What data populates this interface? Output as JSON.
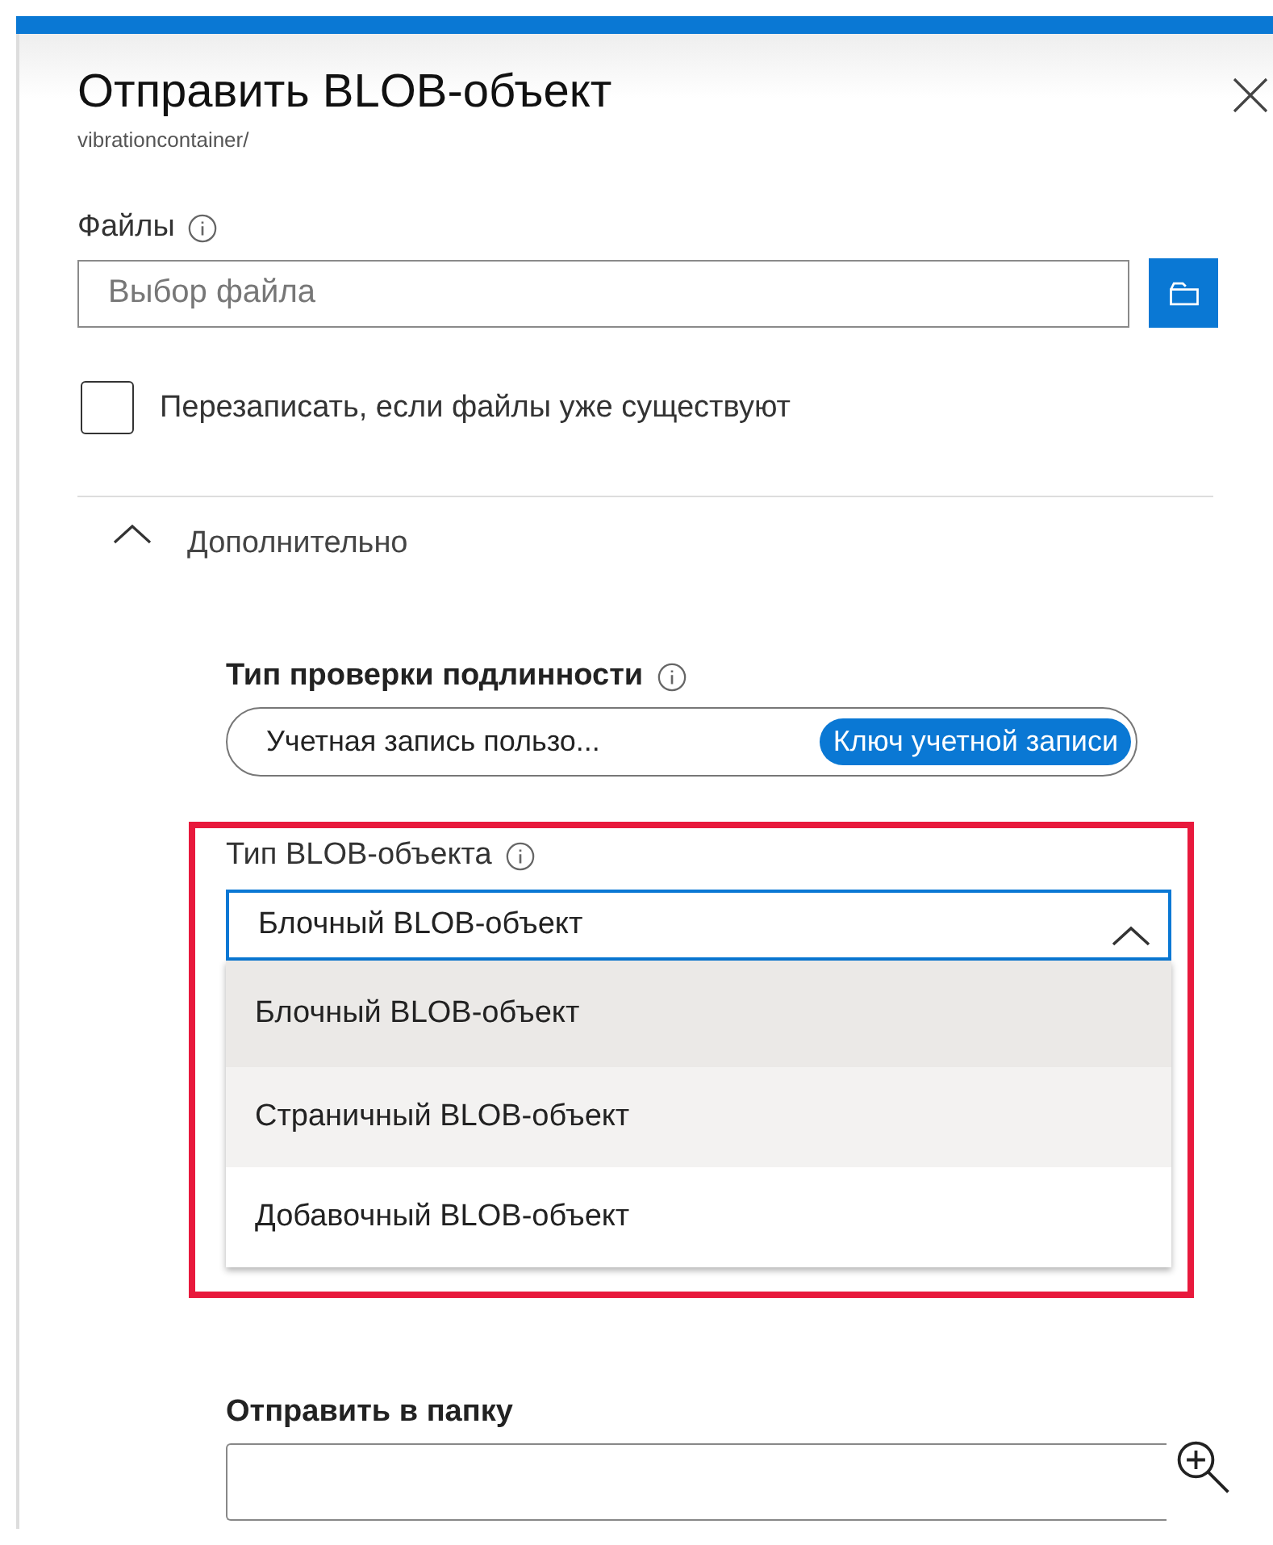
{
  "panel": {
    "title": "Отправить BLOB-объект",
    "subtitle": "vibrationcontainer/"
  },
  "files": {
    "label": "Файлы",
    "placeholder": "Выбор файла"
  },
  "overwrite": {
    "label": "Перезаписать, если файлы уже существуют",
    "checked": false
  },
  "advanced": {
    "label": "Дополнительно",
    "expanded": true
  },
  "auth": {
    "label": "Тип проверки подлинности",
    "options": [
      {
        "label": "Учетная запись пользо...",
        "selected": false
      },
      {
        "label": "Ключ учетной записи",
        "selected": true
      }
    ]
  },
  "blob_type": {
    "label": "Тип BLOB-объекта",
    "value": "Блочный BLOB-объект",
    "expanded": true,
    "options": [
      {
        "label": "Блочный BLOB-объект",
        "selected": true,
        "hovered": false
      },
      {
        "label": "Страничный BLOB-объект",
        "selected": false,
        "hovered": true
      },
      {
        "label": "Добавочный BLOB-объект",
        "selected": false,
        "hovered": false
      }
    ]
  },
  "upload_folder": {
    "label": "Отправить в папку"
  }
}
